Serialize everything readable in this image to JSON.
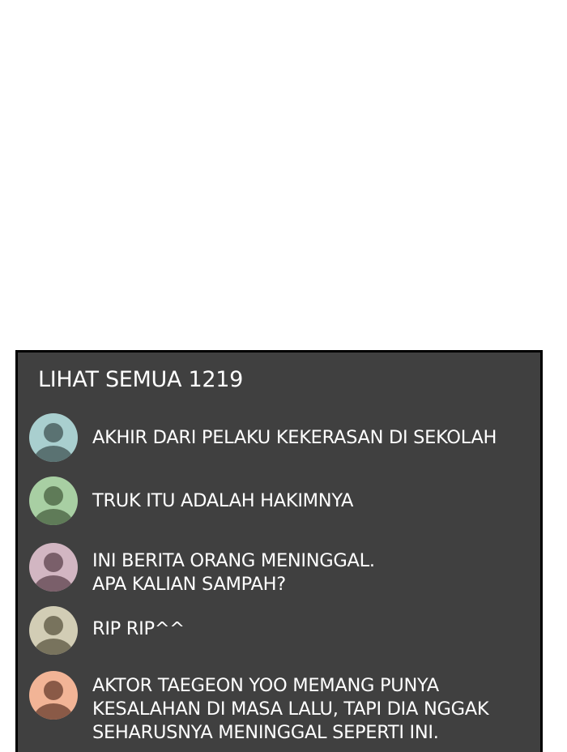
{
  "comments_panel": {
    "header": "LIHAT SEMUA 1219",
    "comments": [
      {
        "avatar_color": "#a9cfcf",
        "avatar_figure_color": "#5a7272",
        "lines": [
          "AKHIR DARI PELAKU KEKERASAN DI SEKOLAH"
        ]
      },
      {
        "avatar_color": "#a8cfa3",
        "avatar_figure_color": "#5f7b58",
        "lines": [
          "TRUK ITU ADALAH HAKIMNYA"
        ]
      },
      {
        "avatar_color": "#d2b6c2",
        "avatar_figure_color": "#7a5f6a",
        "lines": [
          "INI BERITA ORANG MENINGGAL.",
          "APA KALIAN SAMPAH?"
        ]
      },
      {
        "avatar_color": "#d2cdb5",
        "avatar_figure_color": "#78735d",
        "lines": [
          "RIP RIP^^"
        ]
      },
      {
        "avatar_color": "#f2b496",
        "avatar_figure_color": "#8a5a47",
        "lines": [
          "AKTOR TAEGEON YOO MEMANG PUNYA",
          "KESALAHAN DI MASA LALU, TAPI DIA NGGAK",
          "SEHARUSNYA MENINGGAL SEPERTI INI."
        ]
      }
    ]
  }
}
